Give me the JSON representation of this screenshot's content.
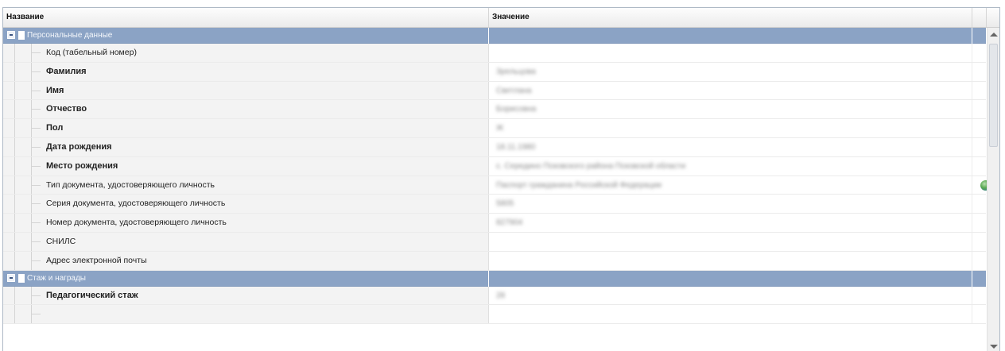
{
  "header": {
    "col_name": "Название",
    "col_value": "Значение"
  },
  "groups": [
    {
      "name": "Персональные данные",
      "rows": [
        {
          "label": "Код (табельный номер)",
          "value": "",
          "bold": false
        },
        {
          "label": "Фамилия",
          "value": "Зрельцова",
          "bold": true
        },
        {
          "label": "Имя",
          "value": "Светлана",
          "bold": true
        },
        {
          "label": "Отчество",
          "value": "Борисовна",
          "bold": true
        },
        {
          "label": "Пол",
          "value": "Ж",
          "bold": true
        },
        {
          "label": "Дата рождения",
          "value": "18.11.1980",
          "bold": true
        },
        {
          "label": "Место рождения",
          "value": "с. Середино Псковского района Псковской области",
          "bold": true
        },
        {
          "label": "Тип документа, удостоверяющего личность",
          "value": "Паспорт гражданина Российской Федерации",
          "bold": false,
          "icon": "lookup-icon"
        },
        {
          "label": "Серия документа, удостоверяющего личность",
          "value": "5805",
          "bold": false
        },
        {
          "label": "Номер документа, удостоверяющего личность",
          "value": "827904",
          "bold": false
        },
        {
          "label": "СНИЛС",
          "value": "",
          "bold": false
        },
        {
          "label": "Адрес электронной почты",
          "value": "",
          "bold": false
        }
      ]
    },
    {
      "name": "Стаж и награды",
      "rows": [
        {
          "label": "Педагогический стаж",
          "value": "28",
          "bold": true
        },
        {
          "label": "",
          "value": "",
          "bold": false
        }
      ]
    }
  ],
  "colors": {
    "group_bg": "#8ba3c5",
    "name_bg": "#f3f3f3",
    "border": "#aeb9c6"
  }
}
